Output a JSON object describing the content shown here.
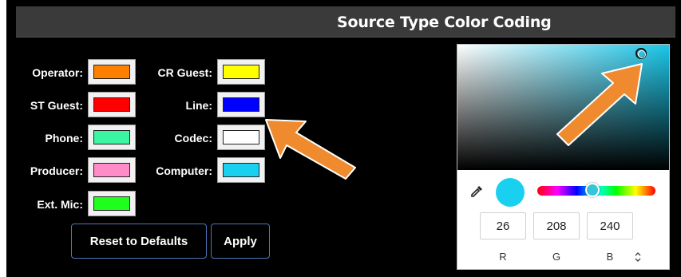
{
  "title": "Source Type Color Coding",
  "colors": [
    {
      "label": "Operator:",
      "color": "#ff8000"
    },
    {
      "label": "CR Guest:",
      "color": "#ffff00"
    },
    {
      "label": "ST Guest:",
      "color": "#ff0000"
    },
    {
      "label": "Line:",
      "color": "#0000ff"
    },
    {
      "label": "Phone:",
      "color": "#3cf5a0"
    },
    {
      "label": "Codec:",
      "color": "#ffffff"
    },
    {
      "label": "Producer:",
      "color": "#ff8cc8"
    },
    {
      "label": "Computer:",
      "color": "#1ad0f0"
    },
    {
      "label": "Ext. Mic:",
      "color": "#1eff1e"
    }
  ],
  "buttons": {
    "reset": "Reset to Defaults",
    "apply": "Apply"
  },
  "picker": {
    "current_color": "#1ad0f0",
    "channels": [
      {
        "label": "R",
        "value": "26"
      },
      {
        "label": "G",
        "value": "208"
      },
      {
        "label": "B",
        "value": "240"
      }
    ],
    "mode_toggle_icon": "up-down-arrows-icon",
    "eyedropper_icon": "eyedropper-icon"
  },
  "annotations": {
    "arrow_color": "#ef8a2e"
  }
}
